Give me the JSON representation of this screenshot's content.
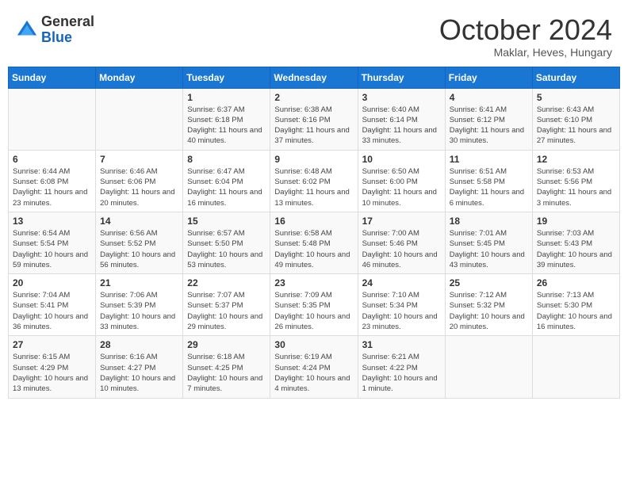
{
  "header": {
    "logo_general": "General",
    "logo_blue": "Blue",
    "month_title": "October 2024",
    "subtitle": "Maklar, Heves, Hungary"
  },
  "weekdays": [
    "Sunday",
    "Monday",
    "Tuesday",
    "Wednesday",
    "Thursday",
    "Friday",
    "Saturday"
  ],
  "weeks": [
    [
      {
        "day": "",
        "sunrise": "",
        "sunset": "",
        "daylight": ""
      },
      {
        "day": "",
        "sunrise": "",
        "sunset": "",
        "daylight": ""
      },
      {
        "day": "1",
        "sunrise": "Sunrise: 6:37 AM",
        "sunset": "Sunset: 6:18 PM",
        "daylight": "Daylight: 11 hours and 40 minutes."
      },
      {
        "day": "2",
        "sunrise": "Sunrise: 6:38 AM",
        "sunset": "Sunset: 6:16 PM",
        "daylight": "Daylight: 11 hours and 37 minutes."
      },
      {
        "day": "3",
        "sunrise": "Sunrise: 6:40 AM",
        "sunset": "Sunset: 6:14 PM",
        "daylight": "Daylight: 11 hours and 33 minutes."
      },
      {
        "day": "4",
        "sunrise": "Sunrise: 6:41 AM",
        "sunset": "Sunset: 6:12 PM",
        "daylight": "Daylight: 11 hours and 30 minutes."
      },
      {
        "day": "5",
        "sunrise": "Sunrise: 6:43 AM",
        "sunset": "Sunset: 6:10 PM",
        "daylight": "Daylight: 11 hours and 27 minutes."
      }
    ],
    [
      {
        "day": "6",
        "sunrise": "Sunrise: 6:44 AM",
        "sunset": "Sunset: 6:08 PM",
        "daylight": "Daylight: 11 hours and 23 minutes."
      },
      {
        "day": "7",
        "sunrise": "Sunrise: 6:46 AM",
        "sunset": "Sunset: 6:06 PM",
        "daylight": "Daylight: 11 hours and 20 minutes."
      },
      {
        "day": "8",
        "sunrise": "Sunrise: 6:47 AM",
        "sunset": "Sunset: 6:04 PM",
        "daylight": "Daylight: 11 hours and 16 minutes."
      },
      {
        "day": "9",
        "sunrise": "Sunrise: 6:48 AM",
        "sunset": "Sunset: 6:02 PM",
        "daylight": "Daylight: 11 hours and 13 minutes."
      },
      {
        "day": "10",
        "sunrise": "Sunrise: 6:50 AM",
        "sunset": "Sunset: 6:00 PM",
        "daylight": "Daylight: 11 hours and 10 minutes."
      },
      {
        "day": "11",
        "sunrise": "Sunrise: 6:51 AM",
        "sunset": "Sunset: 5:58 PM",
        "daylight": "Daylight: 11 hours and 6 minutes."
      },
      {
        "day": "12",
        "sunrise": "Sunrise: 6:53 AM",
        "sunset": "Sunset: 5:56 PM",
        "daylight": "Daylight: 11 hours and 3 minutes."
      }
    ],
    [
      {
        "day": "13",
        "sunrise": "Sunrise: 6:54 AM",
        "sunset": "Sunset: 5:54 PM",
        "daylight": "Daylight: 10 hours and 59 minutes."
      },
      {
        "day": "14",
        "sunrise": "Sunrise: 6:56 AM",
        "sunset": "Sunset: 5:52 PM",
        "daylight": "Daylight: 10 hours and 56 minutes."
      },
      {
        "day": "15",
        "sunrise": "Sunrise: 6:57 AM",
        "sunset": "Sunset: 5:50 PM",
        "daylight": "Daylight: 10 hours and 53 minutes."
      },
      {
        "day": "16",
        "sunrise": "Sunrise: 6:58 AM",
        "sunset": "Sunset: 5:48 PM",
        "daylight": "Daylight: 10 hours and 49 minutes."
      },
      {
        "day": "17",
        "sunrise": "Sunrise: 7:00 AM",
        "sunset": "Sunset: 5:46 PM",
        "daylight": "Daylight: 10 hours and 46 minutes."
      },
      {
        "day": "18",
        "sunrise": "Sunrise: 7:01 AM",
        "sunset": "Sunset: 5:45 PM",
        "daylight": "Daylight: 10 hours and 43 minutes."
      },
      {
        "day": "19",
        "sunrise": "Sunrise: 7:03 AM",
        "sunset": "Sunset: 5:43 PM",
        "daylight": "Daylight: 10 hours and 39 minutes."
      }
    ],
    [
      {
        "day": "20",
        "sunrise": "Sunrise: 7:04 AM",
        "sunset": "Sunset: 5:41 PM",
        "daylight": "Daylight: 10 hours and 36 minutes."
      },
      {
        "day": "21",
        "sunrise": "Sunrise: 7:06 AM",
        "sunset": "Sunset: 5:39 PM",
        "daylight": "Daylight: 10 hours and 33 minutes."
      },
      {
        "day": "22",
        "sunrise": "Sunrise: 7:07 AM",
        "sunset": "Sunset: 5:37 PM",
        "daylight": "Daylight: 10 hours and 29 minutes."
      },
      {
        "day": "23",
        "sunrise": "Sunrise: 7:09 AM",
        "sunset": "Sunset: 5:35 PM",
        "daylight": "Daylight: 10 hours and 26 minutes."
      },
      {
        "day": "24",
        "sunrise": "Sunrise: 7:10 AM",
        "sunset": "Sunset: 5:34 PM",
        "daylight": "Daylight: 10 hours and 23 minutes."
      },
      {
        "day": "25",
        "sunrise": "Sunrise: 7:12 AM",
        "sunset": "Sunset: 5:32 PM",
        "daylight": "Daylight: 10 hours and 20 minutes."
      },
      {
        "day": "26",
        "sunrise": "Sunrise: 7:13 AM",
        "sunset": "Sunset: 5:30 PM",
        "daylight": "Daylight: 10 hours and 16 minutes."
      }
    ],
    [
      {
        "day": "27",
        "sunrise": "Sunrise: 6:15 AM",
        "sunset": "Sunset: 4:29 PM",
        "daylight": "Daylight: 10 hours and 13 minutes."
      },
      {
        "day": "28",
        "sunrise": "Sunrise: 6:16 AM",
        "sunset": "Sunset: 4:27 PM",
        "daylight": "Daylight: 10 hours and 10 minutes."
      },
      {
        "day": "29",
        "sunrise": "Sunrise: 6:18 AM",
        "sunset": "Sunset: 4:25 PM",
        "daylight": "Daylight: 10 hours and 7 minutes."
      },
      {
        "day": "30",
        "sunrise": "Sunrise: 6:19 AM",
        "sunset": "Sunset: 4:24 PM",
        "daylight": "Daylight: 10 hours and 4 minutes."
      },
      {
        "day": "31",
        "sunrise": "Sunrise: 6:21 AM",
        "sunset": "Sunset: 4:22 PM",
        "daylight": "Daylight: 10 hours and 1 minute."
      },
      {
        "day": "",
        "sunrise": "",
        "sunset": "",
        "daylight": ""
      },
      {
        "day": "",
        "sunrise": "",
        "sunset": "",
        "daylight": ""
      }
    ]
  ]
}
